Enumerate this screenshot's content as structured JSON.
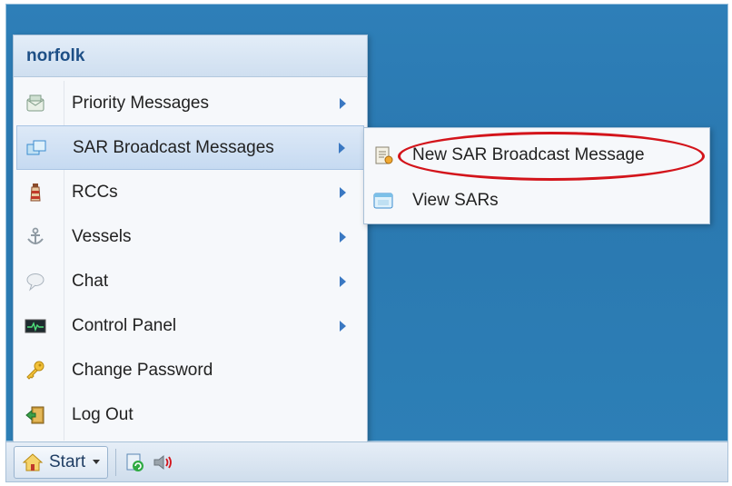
{
  "menu": {
    "user": "norfolk",
    "items": [
      {
        "label": "Priority Messages",
        "icon": "envelope-icon",
        "has_submenu": true
      },
      {
        "label": "SAR Broadcast Messages",
        "icon": "windows-icon",
        "has_submenu": true
      },
      {
        "label": "RCCs",
        "icon": "lighthouse-icon",
        "has_submenu": true
      },
      {
        "label": "Vessels",
        "icon": "anchor-icon",
        "has_submenu": true
      },
      {
        "label": "Chat",
        "icon": "chat-bubble-icon",
        "has_submenu": true
      },
      {
        "label": "Control Panel",
        "icon": "monitor-icon",
        "has_submenu": true
      },
      {
        "label": "Change Password",
        "icon": "key-icon",
        "has_submenu": false
      },
      {
        "label": "Log Out",
        "icon": "exit-door-icon",
        "has_submenu": false
      }
    ]
  },
  "submenu": {
    "items": [
      {
        "label": "New SAR Broadcast Message",
        "icon": "new-document-icon"
      },
      {
        "label": "View SARs",
        "icon": "view-window-icon"
      }
    ]
  },
  "taskbar": {
    "start_label": "Start",
    "icons": [
      "refresh-icon",
      "speaker-icon"
    ]
  },
  "colors": {
    "desktop": "#2e7fb8",
    "menu_header_text": "#1d4f86",
    "highlight_ring": "#d3141b",
    "submenu_arrow": "#3a78c2"
  }
}
